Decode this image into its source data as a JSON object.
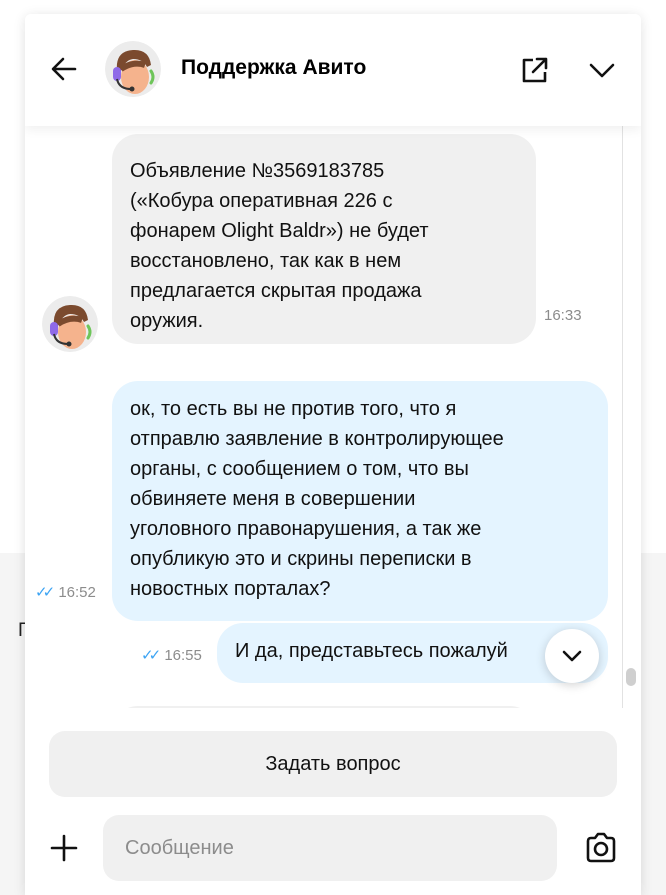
{
  "header": {
    "title": "Поддержка Авито"
  },
  "background": {
    "partial_letter": "Г"
  },
  "messages": [
    {
      "direction": "incoming",
      "text": "Объявление №3569183785\n(«Кобура оперативная 226 с\nфонарем Olight Baldr») не будет\nвосстановлено, так как в нем\nпредлагается скрытая продажа\nоружия.",
      "time": "16:33"
    },
    {
      "direction": "outgoing",
      "text": "ок, то есть вы не против того, что я\nотправлю заявление в контролирующее\nорганы, с сообщением о том, что вы\nобвиняете меня в совершении\nуголовного правонарушения, а так же\nопубликую это и скрины переписки в\nновостных порталах?",
      "time": "16:52",
      "read": true
    },
    {
      "direction": "outgoing",
      "text": "И да, представьтесь пожалуй",
      "time": "16:55",
      "read": true
    }
  ],
  "footer": {
    "ask_button_label": "Задать вопрос",
    "input_placeholder": "Сообщение"
  },
  "colors": {
    "incoming_bubble": "#f0f0f0",
    "outgoing_bubble": "#e4f4ff",
    "read_ticks": "#3da4f3",
    "timestamp": "#8c8c8c",
    "avatar_skin": "#f5b38d",
    "avatar_hair": "#7b4a2e",
    "avatar_headset": "#8f6ae8"
  },
  "icons": {
    "back": "arrow-left-icon",
    "open_external": "open-external-icon",
    "collapse": "chevron-down-icon",
    "scroll_down": "chevron-down-icon",
    "add": "plus-icon",
    "camera": "camera-icon",
    "read_status": "double-check-icon"
  }
}
